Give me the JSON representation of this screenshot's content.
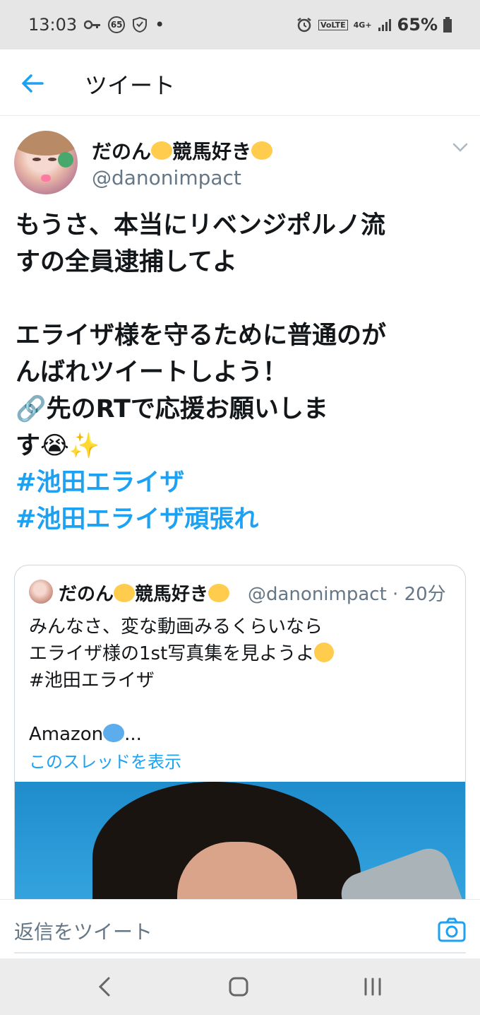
{
  "status_bar": {
    "time": "13:03",
    "badge": "65",
    "dot": "•",
    "volte": "VoLTE",
    "network": "4G+",
    "battery": "65%"
  },
  "header": {
    "title": "ツイート",
    "back_icon": "arrow-left-icon"
  },
  "tweet": {
    "author_name": "だのん",
    "author_name_middle": "競馬好き",
    "handle": "@danonimpact",
    "body": {
      "line1": "もうさ、本当にリベンジポルノ流",
      "line2": "すの全員逮捕してよ",
      "line3": "エライザ様を守るために普通のが",
      "line4": "んばれツイートしよう！",
      "line5": "先のRTで応援お願いしま",
      "line6": "す",
      "hashtag1": "#池田エライザ",
      "hashtag2": "#池田エライザ頑張れ"
    },
    "emojis": {
      "link": "🔗",
      "crying": "😭",
      "sparkles": "✨"
    }
  },
  "quote": {
    "author_name": "だのん",
    "author_name_middle": "競馬好き",
    "handle_time": "@danonimpact · 20分",
    "line1": "みんなさ、変な動画みるくらいなら",
    "line2": "エライザ様の1st写真集を見ようよ",
    "line3": "#池田エライザ",
    "line4": "Amazon",
    "line4_suffix": "...",
    "show_thread": "このスレッドを表示"
  },
  "reply": {
    "placeholder": "返信をツイート",
    "camera_icon": "camera-icon"
  },
  "colors": {
    "accent": "#1da1f2",
    "text": "#14171a",
    "secondary": "#657786",
    "heart_yellow": "#ffcc4d",
    "heart_blue": "#5dadec"
  }
}
